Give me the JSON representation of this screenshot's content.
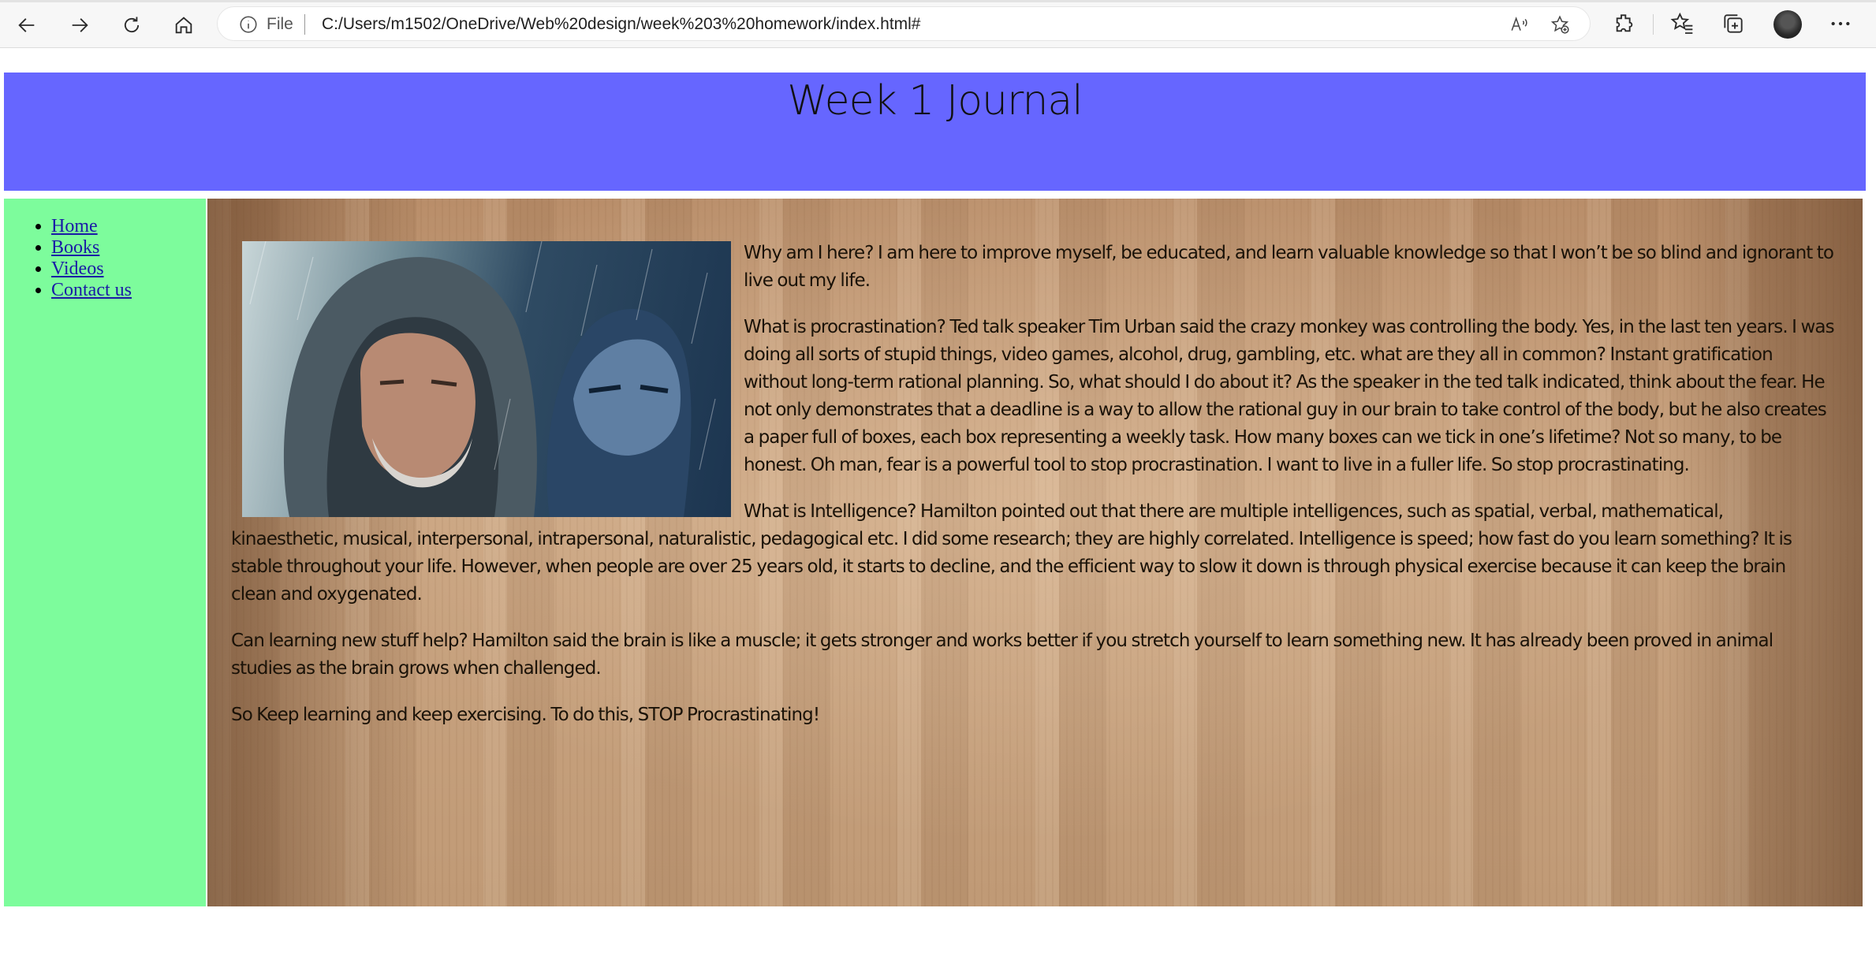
{
  "browser": {
    "address_file_label": "File",
    "url": "C:/Users/m1502/OneDrive/Web%20design/week%203%20homework/index.html#",
    "icons": [
      "back-arrow-icon",
      "forward-arrow-icon",
      "refresh-icon",
      "home-icon",
      "info-icon",
      "read-aloud-icon",
      "add-favorite-icon",
      "extensions-icon",
      "favorites-icon",
      "collections-icon",
      "profile-avatar",
      "more-options-icon"
    ]
  },
  "page": {
    "title": "Week 1 Journal",
    "header_color": "#6666ff",
    "sidebar_color": "#7dfc9c",
    "nav": [
      {
        "label": "Home"
      },
      {
        "label": "Books"
      },
      {
        "label": "Videos"
      },
      {
        "label": "Contact us"
      }
    ],
    "image_description_icon": "hooded-man-and-masked-hero-photo",
    "paragraphs": [
      "Why am I here? I am here to improve myself, be educated, and learn valuable knowledge so that I won’t be so blind and ignorant to live out my life.",
      "What is procrastination? Ted talk speaker Tim Urban said the crazy monkey was controlling the body. Yes, in the last ten years. I was doing all sorts of stupid things, video games, alcohol, drug, gambling, etc. what are they all in common? Instant gratification without long-term rational planning. So, what should I do about it? As the speaker in the ted talk indicated, think about the fear. He not only demonstrates that a deadline is a way to allow the rational guy in our brain to take control of the body, but he also creates a paper full of boxes, each box representing a weekly task. How many boxes can we tick in one’s lifetime? Not so many, to be honest. Oh man, fear is a powerful tool to stop procrastination. I want to live in a fuller life. So stop procrastinating.",
      "What is Intelligence? Hamilton pointed out that there are multiple intelligences, such as spatial, verbal, mathematical, kinaesthetic, musical, interpersonal, intrapersonal, naturalistic, pedagogical etc. I did some research; they are highly correlated. Intelligence is speed; how fast do you learn something? It is stable throughout your life. However, when people are over 25 years old, it starts to decline, and the efficient way to slow it down is through physical exercise because it can keep the brain clean and oxygenated.",
      "Can learning new stuff help? Hamilton said the brain is like a muscle; it gets stronger and works better if you stretch yourself to learn something new. It has already been proved in animal studies as the brain grows when challenged.",
      "So Keep learning and keep exercising. To do this, STOP Procrastinating!"
    ]
  }
}
